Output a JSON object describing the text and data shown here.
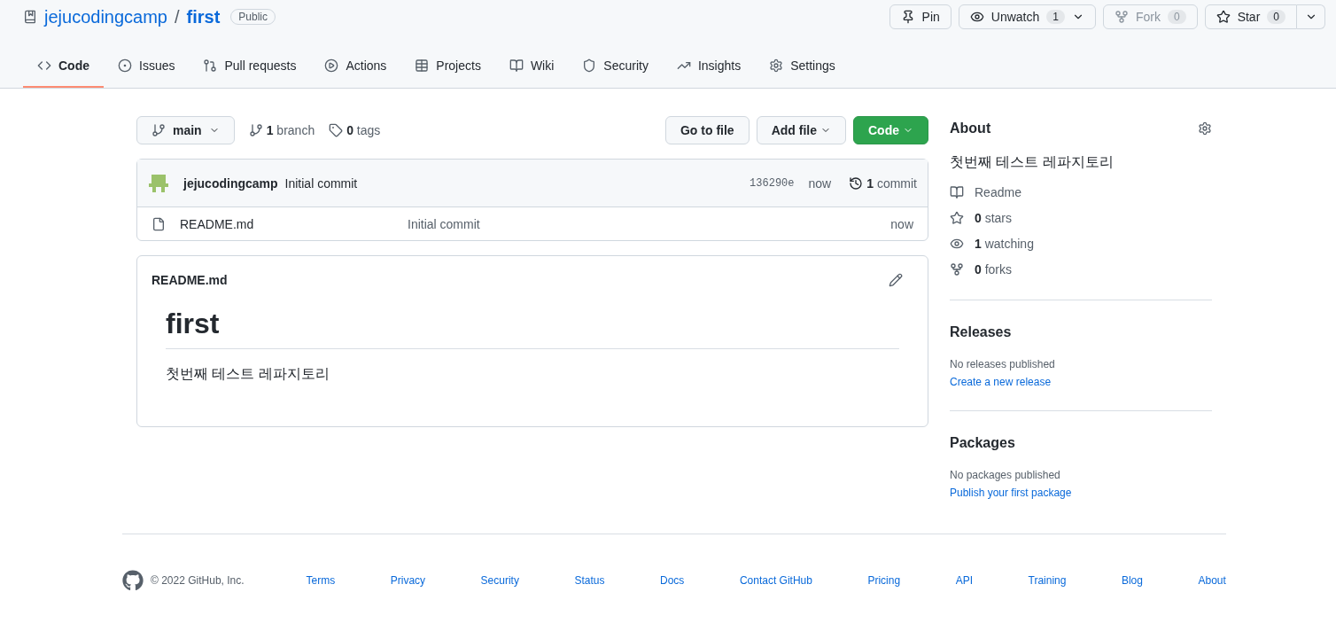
{
  "repo": {
    "owner": "jejucodingcamp",
    "separator": "/",
    "name": "first",
    "visibility": "Public"
  },
  "header_buttons": [
    {
      "kind": "pin",
      "label": "Pin",
      "disabled": false
    },
    {
      "kind": "watch",
      "label": "Unwatch",
      "count": "1",
      "disabled": false
    },
    {
      "kind": "fork",
      "label": "Fork",
      "count": "0",
      "disabled": true
    },
    {
      "kind": "star",
      "label": "Star",
      "count": "0",
      "disabled": false
    }
  ],
  "tabs": [
    {
      "kind": "code",
      "label": "Code",
      "selected": true
    },
    {
      "kind": "issues",
      "label": "Issues",
      "selected": false
    },
    {
      "kind": "pulls",
      "label": "Pull requests",
      "selected": false
    },
    {
      "kind": "actions",
      "label": "Actions",
      "selected": false
    },
    {
      "kind": "projects",
      "label": "Projects",
      "selected": false
    },
    {
      "kind": "wiki",
      "label": "Wiki",
      "selected": false
    },
    {
      "kind": "security",
      "label": "Security",
      "selected": false
    },
    {
      "kind": "insights",
      "label": "Insights",
      "selected": false
    },
    {
      "kind": "settings",
      "label": "Settings",
      "selected": false
    }
  ],
  "branch_bar": {
    "branch": "main",
    "branches": "**1** branch",
    "tags": "**0** tags",
    "buttons": [
      "Go to file",
      "Add file",
      "Code"
    ]
  },
  "commit": {
    "author": "jejucodingcamp",
    "message": "Initial commit",
    "sha": "136290e",
    "time": "now",
    "commits": "**1** commit"
  },
  "files": [
    {
      "name": "README.md",
      "message": "Initial commit",
      "time": "now"
    }
  ],
  "readme": {
    "filename": "README.md",
    "heading": "first",
    "body": "첫번째 테스트 레파지토리"
  },
  "about": {
    "title": "About",
    "description": "첫번째 테스트 레파지토리",
    "items": [
      {
        "kind": "readme",
        "text": "Readme"
      },
      {
        "kind": "stars",
        "text": "**0** stars"
      },
      {
        "kind": "watching",
        "text": "**1** watching"
      },
      {
        "kind": "forks",
        "text": "**0** forks"
      }
    ]
  },
  "releases": {
    "title": "Releases",
    "note": "No releases published",
    "link": "Create a new release"
  },
  "packages": {
    "title": "Packages",
    "note": "No packages published",
    "link": "Publish your first package"
  },
  "footer": {
    "copyright": "© 2022 GitHub, Inc.",
    "links": [
      "Terms",
      "Privacy",
      "Security",
      "Status",
      "Docs",
      "Contact GitHub",
      "Pricing",
      "API",
      "Training",
      "Blog",
      "About"
    ]
  }
}
